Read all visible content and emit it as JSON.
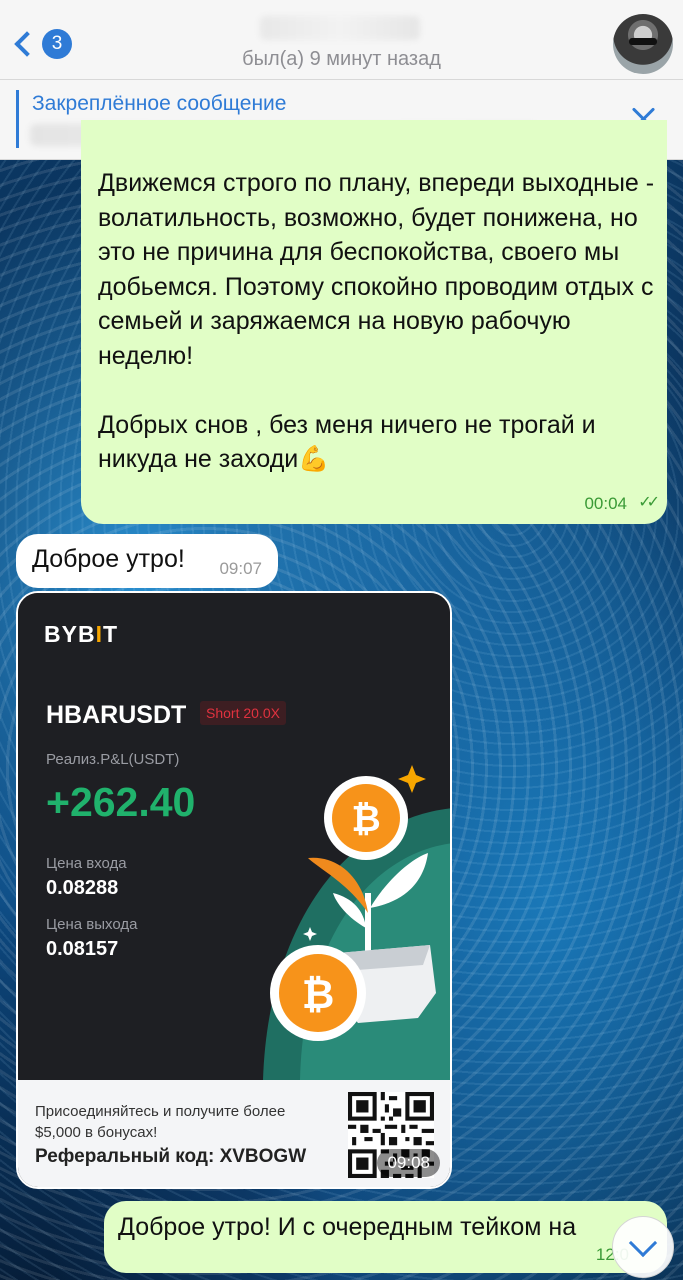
{
  "header": {
    "back_badge": "3",
    "last_seen": "был(а) 9 минут назад"
  },
  "pinned": {
    "title": "Закреплённое сообщение"
  },
  "messages": [
    {
      "direction": "outgoing",
      "text": "Движемся строго по плану, впереди выходные - волатильность, возможно, будет понижена, но это не причина для беспокойства, своего мы добьемся. Поэтому спокойно проводим отдых с семьей и заряжаемся на новую рабочую неделю!\n\nДобрых снов , без меня ничего не трогай и никуда не заходи💪",
      "time": "00:04",
      "read": true
    },
    {
      "direction": "incoming",
      "text": "Доброе утро!",
      "time": "09:07"
    },
    {
      "direction": "incoming",
      "type": "image",
      "time": "09:08",
      "card": {
        "logo": "BYBIT",
        "pair": "HBARUSDT",
        "position": "Short 20.0X",
        "pnl_label": "Реализ.P&L(USDT)",
        "pnl_value": "+262.40",
        "entry_label": "Цена входа",
        "entry_value": "0.08288",
        "exit_label": "Цена выхода",
        "exit_value": "0.08157",
        "promo_text": "Присоединяйтесь и получите более $5,000 в бонусах!",
        "referral": "Реферальный код: XVBOGW"
      }
    },
    {
      "direction": "outgoing",
      "text": "Доброе утро! И с очередным тейком на",
      "time": "12:0"
    }
  ],
  "colors": {
    "accent": "#2f7bd6",
    "outgoing_bubble": "#e1fec6",
    "pnl_green": "#20b26c",
    "short_red": "#e0323f",
    "bybit_orange": "#f7a600"
  }
}
